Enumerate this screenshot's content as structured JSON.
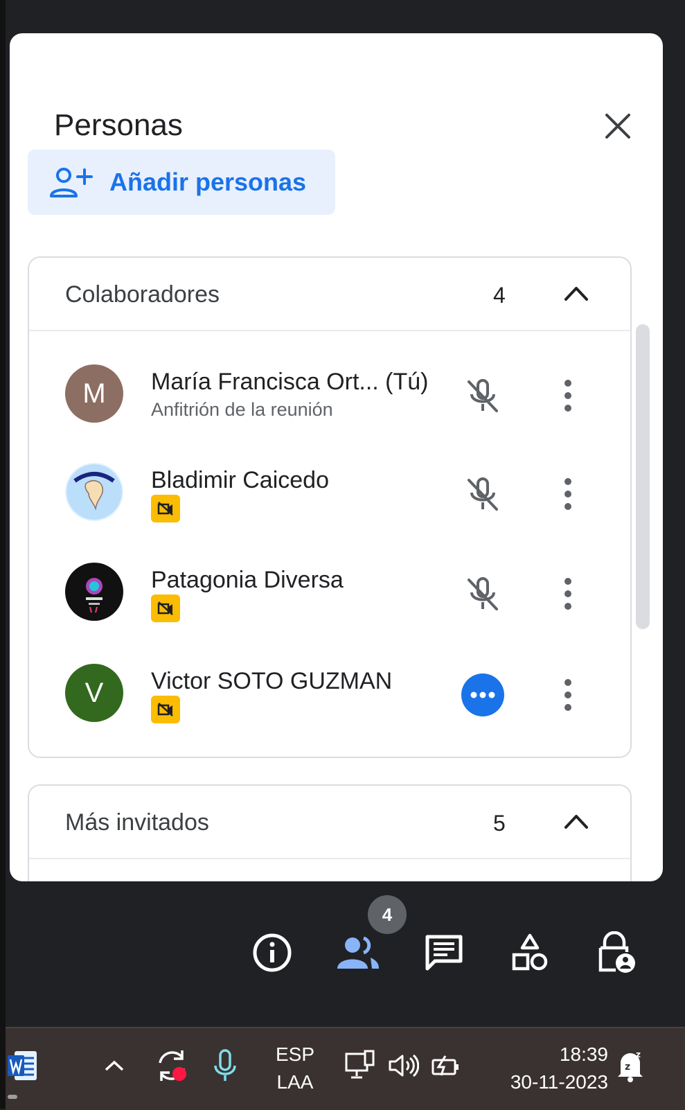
{
  "panel": {
    "title": "Personas",
    "add_people_label": "Añadir personas"
  },
  "collaborators": {
    "title": "Colaboradores",
    "count": "4",
    "people": [
      {
        "initial": "M",
        "name": "María Francisca Ort...  (Tú)",
        "subtitle": "Anfitrión de la reunión",
        "avatar_color": "#8d6e63"
      },
      {
        "initial": "",
        "name": "Bladimir Caicedo",
        "subtitle": ""
      },
      {
        "initial": "",
        "name": "Patagonia Diversa",
        "subtitle": ""
      },
      {
        "initial": "V",
        "name": "Victor SOTO GUZMAN",
        "subtitle": "",
        "avatar_color": "#33691e"
      }
    ]
  },
  "more_invited": {
    "title": "Más invitados",
    "count": "5"
  },
  "controls": {
    "participants_badge": "4",
    "accent_color": "#8ab4f8"
  },
  "taskbar": {
    "language_top": "ESP",
    "language_bottom": "LAA",
    "time": "18:39",
    "date": "30-11-2023"
  }
}
